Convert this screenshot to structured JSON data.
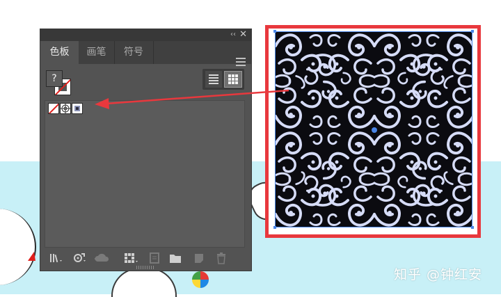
{
  "panel": {
    "tabs": [
      {
        "label": "色板",
        "active": true
      },
      {
        "label": "画笔",
        "active": false
      },
      {
        "label": "符号",
        "active": false
      }
    ],
    "fill_indicator": "?",
    "collapse_glyph": "‹‹",
    "close_glyph": "✕",
    "view_modes": [
      "list-view",
      "thumbnail-view"
    ],
    "active_view": "thumbnail-view",
    "swatches": [
      "none",
      "registration",
      "pattern"
    ],
    "bottom_icons": [
      "swatch-libraries-icon",
      "show-swatch-kinds-icon",
      "cc-libraries-icon",
      "swatch-options-icon",
      "color-group-icon",
      "new-color-group-folder-icon",
      "new-swatch-icon",
      "delete-swatch-icon"
    ]
  },
  "preview": {
    "pattern_colors": {
      "foreground": "#d6dcf7",
      "background": "#0b0b10"
    },
    "frame_color": "#e8383d",
    "selection_color": "#4a86e8"
  },
  "annotation": {
    "arrow_color": "#e8383d"
  },
  "watermark": {
    "text": "知乎 @钟红安"
  }
}
